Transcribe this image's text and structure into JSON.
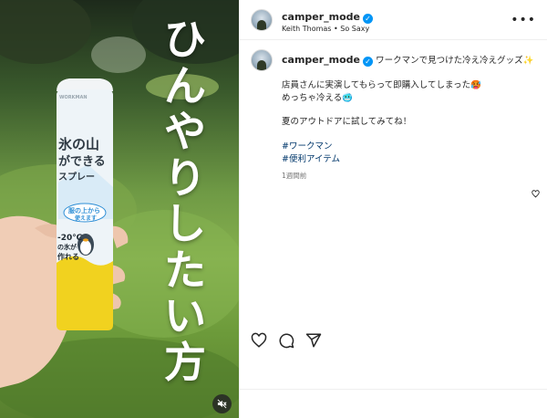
{
  "post": {
    "username": "camper_mode",
    "verified": true,
    "subtitle": "Keith Thomas • So Saxy",
    "caption_title": "ワークマンで見つけた冷え冷えグッズ✨",
    "caption_line1": "店員さんに実演してもらって即購入してしまった🥵",
    "caption_line2": "めっちゃ冷える🥶",
    "caption_line3": "夏のアウトドアに試してみてね！",
    "hashtags": [
      "#ワークマン",
      "#便利アイテム"
    ],
    "time_ago": "1週間前"
  },
  "media": {
    "overlay_text": [
      "ひ",
      "ん",
      "や",
      "り",
      "し",
      "た",
      "い",
      "方"
    ],
    "can": {
      "brand": "WORKMAN",
      "title_1": "氷の山",
      "title_2": "ができる",
      "title_3": "スプレー",
      "badge_1": "服の上から",
      "badge_2": "使えます",
      "temp": "-20℃",
      "temp_sub": "の氷が",
      "temp_sub2": "作れる"
    }
  },
  "icons": {
    "verified": "verified-badge-icon",
    "more": "more-options-icon",
    "like": "heart-icon",
    "comment": "comment-icon",
    "share": "share-icon",
    "mute": "mute-icon"
  },
  "colors": {
    "verified_blue": "#0095f6",
    "hashtag": "#00376b",
    "muted_text": "#737373",
    "can_yellow": "#f1d21f",
    "can_blue": "#2f8fd6"
  }
}
